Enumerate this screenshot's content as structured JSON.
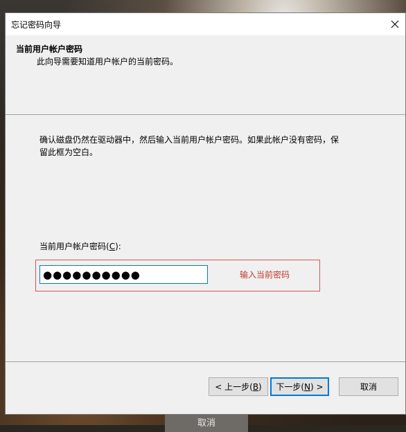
{
  "window": {
    "title": "忘记密码向导",
    "close_icon": "close-icon"
  },
  "header": {
    "title": "当前用户帐户密码",
    "subtitle": "此向导需要知道用户帐户的当前密码。"
  },
  "body": {
    "instruction": "确认磁盘仍然在驱动器中，然后输入当前用户帐户密码。如果此帐户没有密码，保留此框为空白。",
    "password_label_prefix": "当前用户帐户密码(",
    "password_label_key": "C",
    "password_label_suffix": "):",
    "password_value": "●●●●●●●●●●",
    "annotation_hint": "输入当前密码"
  },
  "buttons": {
    "back_prefix": "< 上一步(",
    "back_key": "B",
    "back_suffix": ")",
    "next_prefix": "下一步(",
    "next_key": "N",
    "next_suffix": ") >",
    "cancel": "取消"
  },
  "background": {
    "cancel_button": "取消"
  },
  "colors": {
    "accent": "#0078d7",
    "annotation": "#d9534f"
  }
}
